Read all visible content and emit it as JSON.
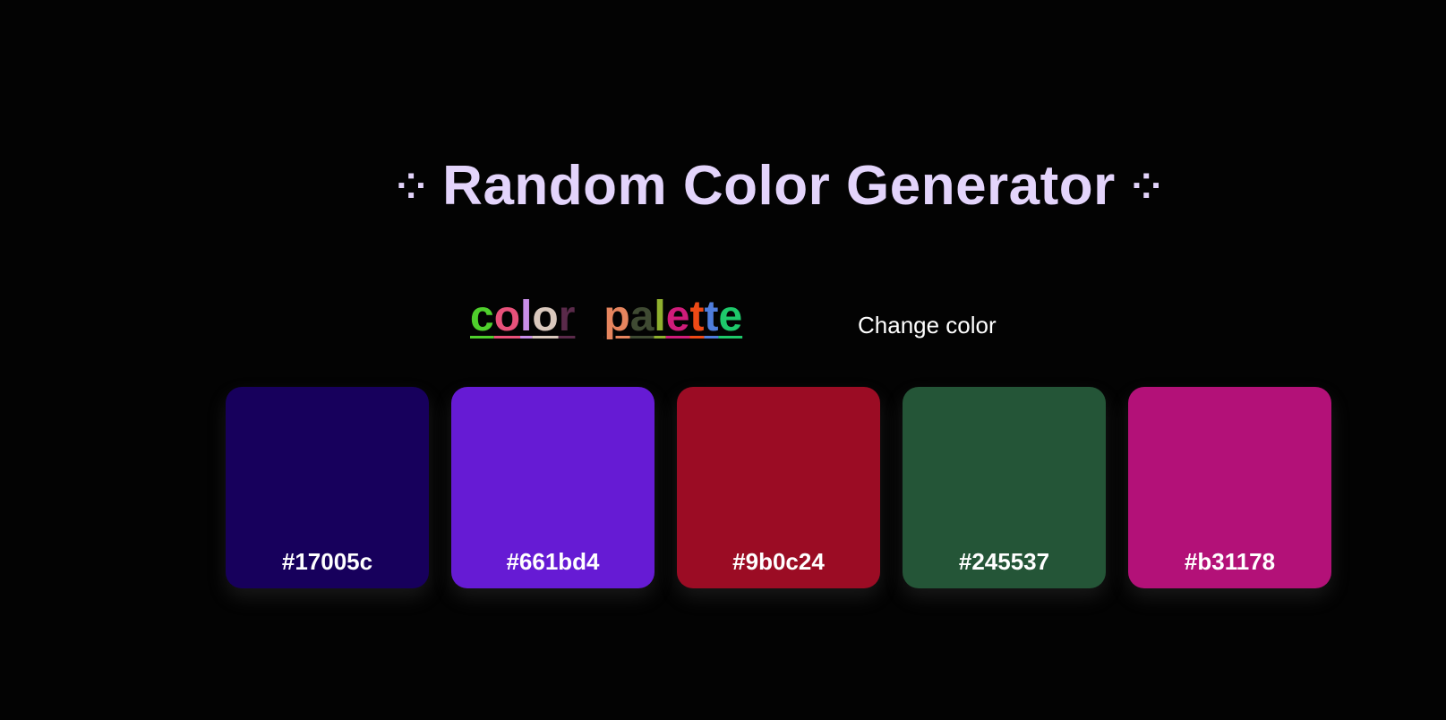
{
  "header": {
    "title": "Random Color Generator",
    "deco_left": "⁘",
    "deco_right": "⁘"
  },
  "palette_heading": {
    "words": [
      [
        {
          "char": "c",
          "color": "#4fcf2c"
        },
        {
          "char": "o",
          "color": "#e8517a"
        },
        {
          "char": "l",
          "color": "#c98ee8"
        },
        {
          "char": "o",
          "color": "#d9c8bd"
        },
        {
          "char": "r",
          "color": "#5a2a4a"
        }
      ],
      [
        {
          "char": "p",
          "color": "#e6855e"
        },
        {
          "char": "a",
          "color": "#3f4a32"
        },
        {
          "char": "l",
          "color": "#8fb02e"
        },
        {
          "char": "e",
          "color": "#d01c7a"
        },
        {
          "char": "t",
          "color": "#ee4a16"
        },
        {
          "char": "t",
          "color": "#4f7ddc"
        },
        {
          "char": "e",
          "color": "#1ec86a"
        }
      ]
    ]
  },
  "actions": {
    "change_color_label": "Change color"
  },
  "swatches": [
    {
      "hex": "#17005c",
      "color": "#17005c"
    },
    {
      "hex": "#661bd4",
      "color": "#661bd4"
    },
    {
      "hex": "#9b0c24",
      "color": "#9b0c24"
    },
    {
      "hex": "#245537",
      "color": "#245537"
    },
    {
      "hex": "#b31178",
      "color": "#b31178"
    }
  ],
  "theme": {
    "background": "#030303",
    "title_color": "#e3d4fb",
    "text_color": "#ffffff"
  }
}
